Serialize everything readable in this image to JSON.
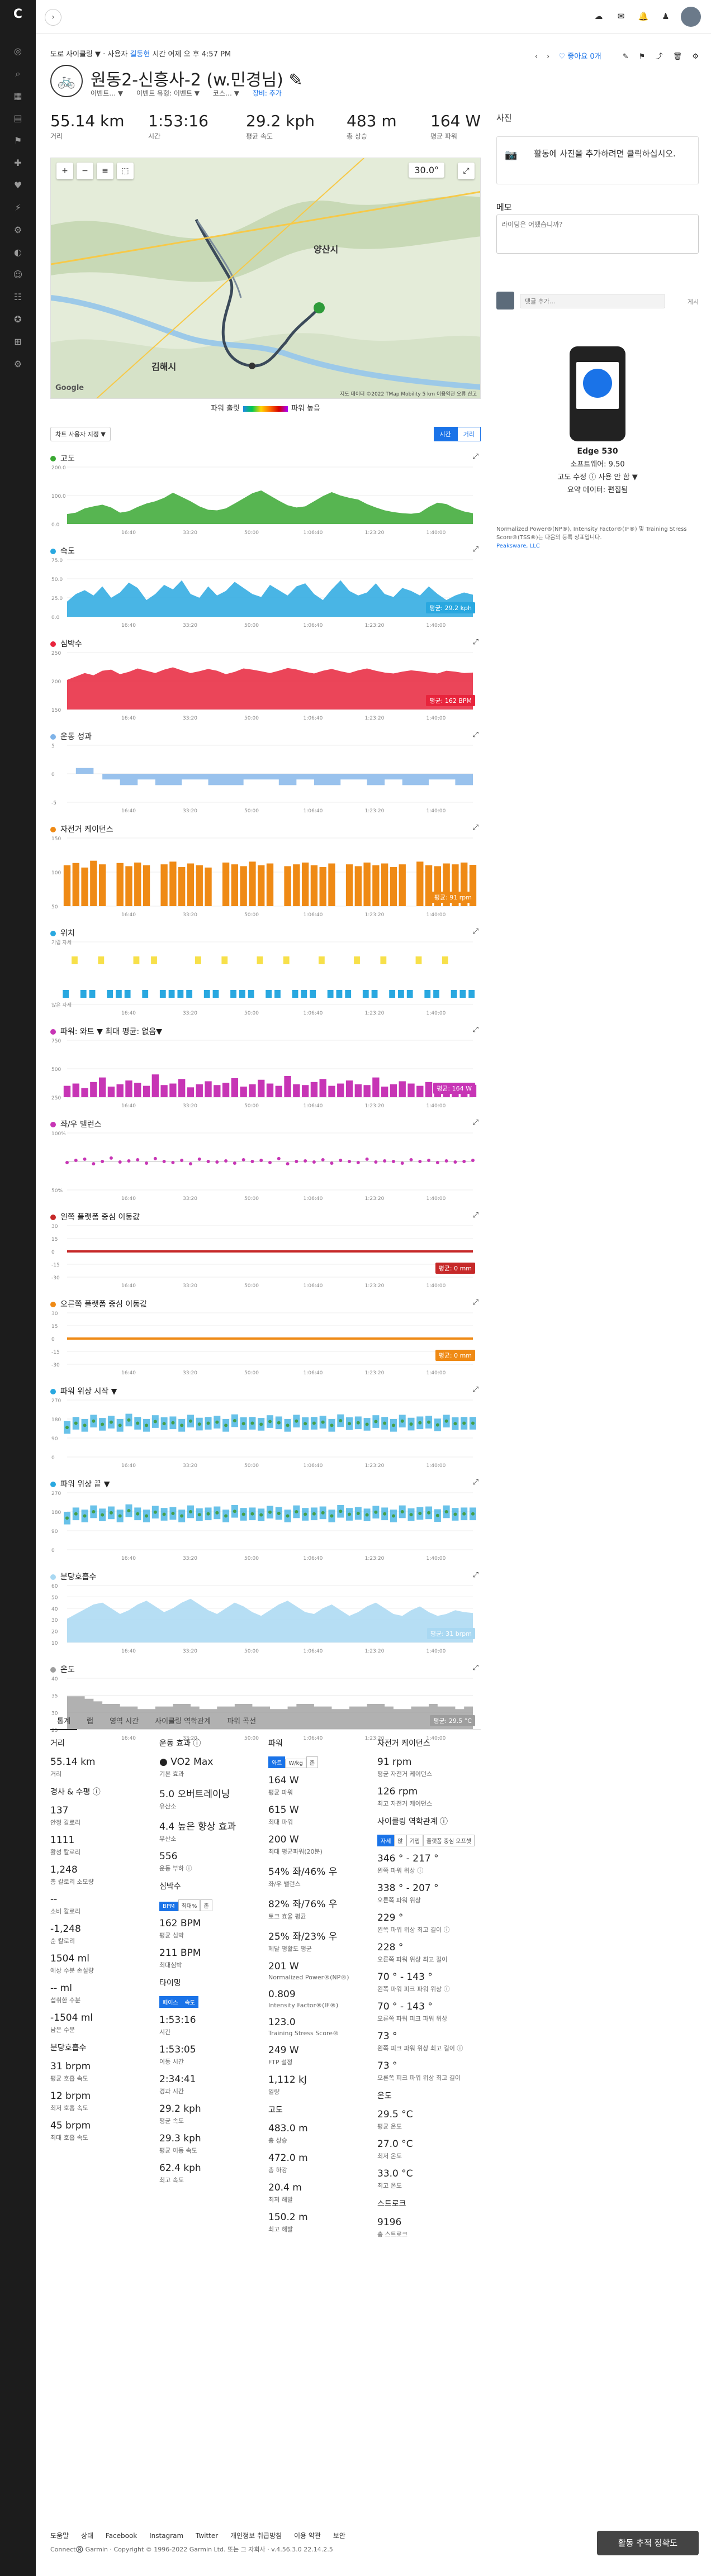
{
  "topbar": {
    "expand_icon": "chevron-right",
    "icons": [
      "cloud-sync-icon",
      "inbox-icon",
      "notification-icon",
      "user-add-icon"
    ]
  },
  "header": {
    "breadcrumb_prefix": "도로 사이클링 ▼ ·  사용자 ",
    "breadcrumb_link": "길동현",
    "breadcrumb_suffix": " 시간 어제 오 후 4:57 PM",
    "title": "원동2-신흥사-2 (w.민경님) ✎",
    "sub_items": [
      "이벤트… ▼",
      "이벤트 유형: 이벤트 ▼",
      "코스… ▼",
      "장비: 추가"
    ],
    "favorite_label": "♡ 좋아요 0개",
    "nav_prev": "‹",
    "nav_next": "›"
  },
  "summary": [
    {
      "value": "55.14 km",
      "label": "거리"
    },
    {
      "value": "1:53:16",
      "label": "시간"
    },
    {
      "value": "29.2 kph",
      "label": "평균 속도"
    },
    {
      "value": "483 m",
      "label": "총 상승"
    },
    {
      "value": "164 W",
      "label": "평균 파워"
    }
  ],
  "map": {
    "zoom_label": "30.0°",
    "labels": [
      {
        "text": "양산시"
      },
      {
        "text": "김해시"
      }
    ],
    "footer": "지도 데이터 ©2022 TMap Mobility  5 km  이용약관  오류 신고",
    "google": "Google"
  },
  "legend": {
    "left": "파워 출릿",
    "right": "파워 높음"
  },
  "chart_controls": {
    "selector": "차트 사용자 지정 ▼",
    "toggle": [
      "시간",
      "거리"
    ]
  },
  "x_ticks": [
    "16:40",
    "33:20",
    "50:00",
    "1:06:40",
    "1:23:20",
    "1:40:00"
  ],
  "chart_data": [
    {
      "type": "area",
      "title": "고도",
      "color": "#3aa832",
      "ylim": [
        0,
        200
      ],
      "yticks": [
        "200.0",
        "100.0",
        "0.0"
      ],
      "values": [
        35,
        40,
        55,
        62,
        68,
        58,
        40,
        45,
        60,
        72,
        80,
        92,
        110,
        95,
        80,
        62,
        50,
        48,
        55,
        72,
        90,
        108,
        118,
        100,
        82,
        66,
        58,
        62,
        80,
        98,
        112,
        100,
        92,
        86,
        70,
        58,
        48,
        42,
        38,
        36,
        40,
        60,
        75,
        70,
        55,
        44,
        38
      ],
      "badge": ""
    },
    {
      "type": "area",
      "title": "속도",
      "color": "#29a8e0",
      "ylim": [
        0,
        75
      ],
      "yticks": [
        "75.0",
        "50.0",
        "25.0",
        "0.0"
      ],
      "values": [
        20,
        30,
        35,
        28,
        40,
        25,
        32,
        45,
        38,
        22,
        30,
        42,
        36,
        48,
        30,
        25,
        40,
        28,
        34,
        46,
        38,
        30,
        26,
        42,
        35,
        28,
        40,
        44,
        30,
        22,
        36,
        48,
        34,
        28,
        32,
        44,
        30,
        26,
        38,
        34,
        28,
        40,
        30,
        22,
        28,
        32,
        29
      ],
      "badge": "평균: 29.2 kph"
    },
    {
      "type": "area",
      "title": "심박수",
      "color": "#e8243c",
      "ylim": [
        0,
        250
      ],
      "yticks": [
        "250",
        "200",
        "150"
      ],
      "values": [
        130,
        145,
        160,
        150,
        170,
        175,
        155,
        165,
        180,
        170,
        160,
        175,
        185,
        172,
        160,
        168,
        178,
        170,
        155,
        165,
        180,
        175,
        168,
        160,
        170,
        182,
        176,
        165,
        158,
        170,
        178,
        168,
        160,
        172,
        180,
        170,
        162,
        158,
        166,
        172,
        168,
        162,
        158,
        170,
        166,
        160,
        162
      ],
      "badge": "평균: 162 BPM"
    },
    {
      "type": "step",
      "title": "운동 성과",
      "color": "#7fb3e8",
      "ylim": [
        -5,
        5
      ],
      "yticks": [
        "5",
        "0",
        "-5"
      ],
      "values": [
        0,
        1,
        1,
        0,
        -1,
        -1,
        -2,
        -2,
        -1,
        -1,
        -2,
        -2,
        -2,
        -1,
        -1,
        -1,
        -2,
        -2,
        -2,
        -2,
        -1,
        -1,
        -1,
        -1,
        -2,
        -2,
        -1,
        -1,
        -2,
        -2,
        -2,
        -1,
        -1,
        -1,
        -2,
        -2,
        -1,
        -1,
        -2,
        -2,
        -2,
        -1,
        -1,
        -1,
        -2,
        -2,
        -2
      ],
      "badge": ""
    },
    {
      "type": "bars",
      "title": "자전거 케이던스",
      "color": "#ef8a15",
      "ylim": [
        0,
        150
      ],
      "yticks": [
        "150",
        "100",
        "50"
      ],
      "values": [
        90,
        95,
        85,
        100,
        92,
        0,
        95,
        88,
        96,
        90,
        0,
        92,
        98,
        86,
        94,
        90,
        85,
        0,
        96,
        92,
        88,
        98,
        90,
        94,
        0,
        88,
        92,
        96,
        90,
        86,
        94,
        0,
        92,
        88,
        96,
        90,
        94,
        86,
        92,
        0,
        98,
        90,
        88,
        94,
        92,
        96,
        91
      ],
      "badge": "평균: 91 rpm"
    },
    {
      "type": "position",
      "title": "위치",
      "color": "#29a8e0",
      "ylim": [
        0,
        1
      ],
      "yticks": [
        "기립 자세",
        "앉은 자세"
      ],
      "values": [
        0,
        1,
        0,
        0,
        1,
        0,
        0,
        0,
        1,
        0,
        1,
        0,
        0,
        0,
        0,
        1,
        0,
        0,
        1,
        0,
        0,
        0,
        1,
        0,
        0,
        1,
        0,
        0,
        0,
        1,
        0,
        0,
        0,
        1,
        0,
        0,
        1,
        0,
        0,
        0,
        1,
        0,
        0,
        1,
        0,
        0,
        0
      ],
      "badge": ""
    },
    {
      "type": "bars",
      "title": "파워: 와트 ▼   최대 평균: 없음▼",
      "color": "#c735b5",
      "ylim": [
        0,
        750
      ],
      "yticks": [
        "750",
        "500",
        "250"
      ],
      "values": [
        150,
        180,
        120,
        200,
        260,
        140,
        170,
        220,
        190,
        150,
        300,
        160,
        180,
        240,
        130,
        170,
        210,
        160,
        190,
        250,
        140,
        170,
        230,
        180,
        150,
        280,
        170,
        160,
        200,
        240,
        150,
        180,
        220,
        170,
        160,
        260,
        140,
        170,
        210,
        180,
        150,
        200,
        170,
        160,
        190,
        150,
        164
      ],
      "badge": "평균: 164 W"
    },
    {
      "type": "scatter",
      "title": "좌/우 밸런스",
      "color": "#c735b5",
      "ylim": [
        0,
        100
      ],
      "yticks": [
        "100%",
        "50%"
      ],
      "values": [
        48,
        52,
        54,
        46,
        50,
        56,
        49,
        51,
        53,
        47,
        55,
        50,
        48,
        52,
        46,
        54,
        50,
        49,
        51,
        47,
        53,
        50,
        52,
        48,
        55,
        46,
        50,
        51,
        49,
        53,
        47,
        52,
        50,
        48,
        54,
        49,
        51,
        50,
        47,
        53,
        50,
        52,
        48,
        51,
        49,
        50,
        52
      ],
      "badge": ""
    },
    {
      "type": "flat",
      "title": "왼쪽 플랫폼 중심 이동값",
      "color": "#c62828",
      "ylim": [
        -30,
        30
      ],
      "yticks": [
        "30",
        "15",
        "0",
        "-15",
        "-30"
      ],
      "values": [
        0,
        0,
        0,
        0,
        0,
        0,
        0,
        0,
        0,
        0,
        0,
        0,
        0,
        0,
        0,
        0,
        0,
        0,
        0,
        0,
        0,
        0,
        0,
        0,
        0,
        0,
        0,
        0,
        0,
        0,
        0,
        0,
        0,
        0,
        0,
        0,
        0,
        0,
        0,
        0,
        0,
        0,
        0,
        0,
        0,
        0,
        0
      ],
      "badge": "평균: 0 mm"
    },
    {
      "type": "flat",
      "title": "오른쪽 플랫폼 중심 이동값",
      "color": "#ef8a15",
      "ylim": [
        -30,
        30
      ],
      "yticks": [
        "30",
        "15",
        "0",
        "-15",
        "-30"
      ],
      "values": [
        0,
        0,
        0,
        0,
        0,
        0,
        0,
        0,
        0,
        0,
        0,
        0,
        0,
        0,
        0,
        0,
        0,
        0,
        0,
        0,
        0,
        0,
        0,
        0,
        0,
        0,
        0,
        0,
        0,
        0,
        0,
        0,
        0,
        0,
        0,
        0,
        0,
        0,
        0,
        0,
        0,
        0,
        0,
        0,
        0,
        0,
        0
      ],
      "badge": "평균: 0 mm"
    },
    {
      "type": "band",
      "title": "파워 위상 시작 ▼",
      "color": "#29a8e0",
      "ylim": [
        0,
        270
      ],
      "yticks": [
        "270",
        "180",
        "90",
        "0"
      ],
      "values": [
        140,
        160,
        150,
        170,
        155,
        165,
        150,
        175,
        160,
        150,
        168,
        158,
        162,
        150,
        170,
        156,
        160,
        165,
        150,
        172,
        158,
        160,
        155,
        168,
        162,
        150,
        170,
        158,
        160,
        165,
        150,
        172,
        158,
        162,
        155,
        168,
        160,
        150,
        170,
        156,
        162,
        165,
        152,
        170,
        158,
        160,
        160
      ],
      "badge": ""
    },
    {
      "type": "band",
      "title": "파워 위상 끝 ▼",
      "color": "#29a8e0",
      "ylim": [
        0,
        270
      ],
      "yticks": [
        "270",
        "180",
        "90",
        "0"
      ],
      "values": [
        150,
        170,
        160,
        180,
        165,
        175,
        160,
        185,
        170,
        160,
        178,
        168,
        172,
        160,
        180,
        166,
        170,
        175,
        160,
        182,
        168,
        170,
        165,
        178,
        172,
        160,
        180,
        168,
        170,
        175,
        160,
        182,
        168,
        172,
        165,
        178,
        170,
        160,
        180,
        166,
        172,
        175,
        162,
        180,
        168,
        170,
        170
      ],
      "badge": ""
    },
    {
      "type": "area",
      "title": "분당호흡수",
      "color": "#a9d8f2",
      "ylim": [
        0,
        60
      ],
      "yticks": [
        "60",
        "50",
        "40",
        "30",
        "20",
        "10"
      ],
      "values": [
        25,
        30,
        35,
        40,
        42,
        36,
        30,
        34,
        40,
        44,
        38,
        32,
        36,
        42,
        46,
        40,
        34,
        30,
        36,
        42,
        38,
        32,
        28,
        34,
        40,
        44,
        38,
        32,
        30,
        36,
        40,
        34,
        28,
        32,
        38,
        42,
        36,
        30,
        28,
        34,
        38,
        32,
        28,
        30,
        34,
        32,
        31
      ],
      "badge": "평균: 31 brpm"
    },
    {
      "type": "step",
      "title": "온도",
      "color": "#9e9e9e",
      "ylim": [
        20,
        40
      ],
      "yticks": [
        "40",
        "35",
        "30",
        "25"
      ],
      "values": [
        33,
        33,
        32,
        31,
        30,
        30,
        29,
        29,
        28,
        28,
        29,
        29,
        30,
        30,
        29,
        28,
        28,
        29,
        29,
        30,
        30,
        29,
        29,
        28,
        28,
        29,
        30,
        30,
        29,
        29,
        28,
        28,
        29,
        29,
        30,
        30,
        29,
        28,
        28,
        29,
        29,
        30,
        29,
        29,
        28,
        29,
        29
      ],
      "badge": "평균: 29.5 °C"
    }
  ],
  "right_column": {
    "photo_heading": "사진",
    "photo_text": "활동에 사진을 추가하려면 클릭하십시오.",
    "memo_heading": "메모",
    "memo_placeholder": "라이딩은 어땠습니까?",
    "comment_placeholder": "댓글 추가...",
    "comment_post": "게시",
    "device_name": "Edge 530",
    "software": "소프트웨어: 9.50",
    "elevation": "고도 수정 ⓘ 사용 안 함 ▼",
    "summary_data": "요약 데이터: 편집됨",
    "note": "Normalized Power®(NP®), Intensity Factor®(IF®) 및 Training Stress Score®(TSS®)는 다음의 등록 상표입니다.",
    "note_link": "Peaksware, LLC"
  },
  "bottom_tabs": [
    "통계",
    "랩",
    "영역 시간",
    "사이클링 역학관계",
    "파워 곡선"
  ],
  "stats_col1": [
    {
      "h": "거리"
    },
    {
      "v": "55.14 km",
      "l": "거리"
    },
    {
      "h": "경사 & 수평 ⓘ"
    },
    {
      "v": "137",
      "l": "안정 칼로리"
    },
    {
      "v": "1111",
      "l": "활성 칼로리"
    },
    {
      "v": "1,248",
      "l": "총 칼로리 소모량"
    },
    {
      "v": "--",
      "l": "소비 칼로리"
    },
    {
      "v": "-1,248",
      "l": "순 칼로리"
    },
    {
      "v": "1504 ml",
      "l": "예상 수분 손실량"
    },
    {
      "v": "-- ml",
      "l": "섭취한 수분"
    },
    {
      "v": "-1504 ml",
      "l": "남은 수분"
    },
    {
      "h": "분당호흡수"
    },
    {
      "v": "31 brpm",
      "l": "평균 호흡 속도"
    },
    {
      "v": "12 brpm",
      "l": "최저 호흡 속도"
    },
    {
      "v": "45 brpm",
      "l": "최대 호흡 속도"
    }
  ],
  "stats_col2": [
    {
      "h": "운동 효과 ⓘ"
    },
    {
      "v": "● VO2 Max",
      "l": "기본 효과"
    },
    {
      "v": "5.0 오버트레이닝",
      "l": "유산소"
    },
    {
      "v": "4.4 높은 향상 효과",
      "l": "무산소"
    },
    {
      "v": "556",
      "l": "운동 부하 ⓘ"
    },
    {
      "h": "심박수"
    },
    {
      "btns": [
        "BPM",
        "최대%",
        "존"
      ]
    },
    {
      "v": "162 BPM",
      "l": "평균 심박"
    },
    {
      "v": "211 BPM",
      "l": "최대심박"
    },
    {
      "h": "타이밍"
    },
    {
      "btns": [
        "페이스",
        "속도"
      ]
    },
    {
      "v": "1:53:16",
      "l": "시간"
    },
    {
      "v": "1:53:05",
      "l": "이동 시간"
    },
    {
      "v": "2:34:41",
      "l": "경과 시간"
    },
    {
      "v": "29.2 kph",
      "l": "평균 속도"
    },
    {
      "v": "29.3 kph",
      "l": "평균 이동 속도"
    },
    {
      "v": "62.4 kph",
      "l": "최고 속도"
    }
  ],
  "stats_col3": [
    {
      "h": "파워"
    },
    {
      "btns": [
        "와트",
        "W/kg",
        "존"
      ]
    },
    {
      "v": "164 W",
      "l": "평균 파워"
    },
    {
      "v": "615 W",
      "l": "최대 파워"
    },
    {
      "v": "200 W",
      "l": "최대 평균파워(20분)"
    },
    {
      "v": "54% 좌/46% 우",
      "l": "좌/우 밸런스"
    },
    {
      "v": "82% 좌/76% 우",
      "l": "토크 효율 평균"
    },
    {
      "v": "25% 좌/23% 우",
      "l": "페달 평활도 평균"
    },
    {
      "v": "201 W",
      "l": "Normalized Power®(NP®)"
    },
    {
      "v": "0.809",
      "l": "Intensity Factor®(IF®)"
    },
    {
      "v": "123.0",
      "l": "Training Stress Score®"
    },
    {
      "v": "249 W",
      "l": "FTP 설정"
    },
    {
      "v": "1,112 kJ",
      "l": "일량"
    },
    {
      "h": "고도"
    },
    {
      "v": "483.0 m",
      "l": "총 상승"
    },
    {
      "v": "472.0 m",
      "l": "총 하강"
    },
    {
      "v": "20.4 m",
      "l": "최저 해발"
    },
    {
      "v": "150.2 m",
      "l": "최고 해발"
    }
  ],
  "stats_col4": [
    {
      "h": "자전거 케이던스"
    },
    {
      "v": "91 rpm",
      "l": "평균 자전거 케이던스"
    },
    {
      "v": "126 rpm",
      "l": "최고 자전거 케이던스"
    },
    {
      "h": "사이클링 역학관계 ⓘ"
    },
    {
      "btns": [
        "자세",
        "앉",
        "기립",
        "플랫폼 중심 오프셋"
      ]
    },
    {
      "v": "346 ° - 217 °",
      "l": "왼쪽 파워 위상 ⓘ"
    },
    {
      "v": "338 ° - 207 °",
      "l": "오른쪽 파워 위상"
    },
    {
      "v": "229 °",
      "l": "왼쪽 파워 위상 최고 길이 ⓘ"
    },
    {
      "v": "228 °",
      "l": "오른쪽 파워 위상 최고 길이"
    },
    {
      "v": "70 ° - 143 °",
      "l": "왼쪽 파워 피크 파워 위상 ⓘ"
    },
    {
      "v": "70 ° - 143 °",
      "l": "오른쪽 파워 피크 파워 위상"
    },
    {
      "v": "73 °",
      "l": "왼쪽 피크 파워 위상 최고 길이 ⓘ"
    },
    {
      "v": "73 °",
      "l": "오른쪽 피크 파워 위상 최고 길이"
    },
    {
      "h": "온도"
    },
    {
      "v": "29.5 °C",
      "l": "평균 온도"
    },
    {
      "v": "27.0 °C",
      "l": "최저 온도"
    },
    {
      "v": "33.0 °C",
      "l": "최고 온도"
    },
    {
      "h": "스트로크"
    },
    {
      "v": "9196",
      "l": "총 스트로크"
    }
  ],
  "footer": {
    "links": [
      "도움말",
      "상태",
      "Facebook",
      "Instagram",
      "Twitter",
      "개인정보 취급방침",
      "이용 약관",
      "보안"
    ],
    "copyright": "Connect®️ Garmin · Copyright © 1996-2022 Garmin Ltd. 또는 그 자회사 · v.4.56.3.0 22.14.2.5",
    "track_button": "활동 추적 정확도"
  }
}
